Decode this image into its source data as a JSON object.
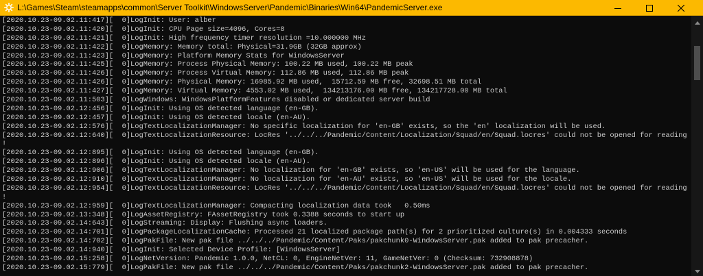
{
  "window": {
    "title": "L:\\Games\\Steam\\steamapps\\common\\Server Toolkit\\WindowsServer\\Pandemic\\Binaries\\Win64\\PandemicServer.exe",
    "titlebar_color": "#fcb900",
    "console_background": "#0c0c0c",
    "console_text_color": "#cccccc",
    "icon": "app-gear-icon"
  },
  "controls": {
    "minimize_icon": "minimize-icon",
    "maximize_icon": "maximize-icon",
    "close_icon": "close-icon"
  },
  "console": {
    "lines": [
      "[2020.10.23-09.02.11:417][  0]LogInit: User: alber",
      "[2020.10.23-09.02.11:420][  0]LogInit: CPU Page size=4096, Cores=8",
      "[2020.10.23-09.02.11:421][  0]LogInit: High frequency timer resolution =10.000000 MHz",
      "[2020.10.23-09.02.11:422][  0]LogMemory: Memory total: Physical=31.9GB (32GB approx)",
      "[2020.10.23-09.02.11:423][  0]LogMemory: Platform Memory Stats for WindowsServer",
      "[2020.10.23-09.02.11:425][  0]LogMemory: Process Physical Memory: 100.22 MB used, 100.22 MB peak",
      "[2020.10.23-09.02.11:426][  0]LogMemory: Process Virtual Memory: 112.86 MB used, 112.86 MB peak",
      "[2020.10.23-09.02.11:426][  0]LogMemory: Physical Memory: 16985.92 MB used,  15712.59 MB free, 32698.51 MB total",
      "[2020.10.23-09.02.11:427][  0]LogMemory: Virtual Memory: 4553.02 MB used,  134213176.00 MB free, 134217728.00 MB total",
      "[2020.10.23-09.02.11:503][  0]LogWindows: WindowsPlatformFeatures disabled or dedicated server build",
      "[2020.10.23-09.02.12:456][  0]LogInit: Using OS detected language (en-GB).",
      "[2020.10.23-09.02.12:457][  0]LogInit: Using OS detected locale (en-AU).",
      "[2020.10.23-09.02.12:576][  0]LogTextLocalizationManager: No specific localization for 'en-GB' exists, so the 'en' localization will be used.",
      "[2020.10.23-09.02.12:640][  0]LogTextLocalizationResource: LocRes '../../../Pandemic/Content/Localization/Squad/en/Squad.locres' could not be opened for reading",
      "!",
      "[2020.10.23-09.02.12:895][  0]LogInit: Using OS detected language (en-GB).",
      "[2020.10.23-09.02.12:896][  0]LogInit: Using OS detected locale (en-AU).",
      "[2020.10.23-09.02.12:906][  0]LogTextLocalizationManager: No localization for 'en-GB' exists, so 'en-US' will be used for the language.",
      "[2020.10.23-09.02.12:910][  0]LogTextLocalizationManager: No localization for 'en-AU' exists, so 'en-US' will be used for the locale.",
      "[2020.10.23-09.02.12:954][  0]LogTextLocalizationResource: LocRes '../../../Pandemic/Content/Localization/Squad/en/Squad.locres' could not be opened for reading",
      "!",
      "[2020.10.23-09.02.12:959][  0]LogTextLocalizationManager: Compacting localization data took   0.50ms",
      "[2020.10.23-09.02.13:348][  0]LogAssetRegistry: FAssetRegistry took 0.3388 seconds to start up",
      "[2020.10.23-09.02.14:643][  0]LogStreaming: Display: Flushing async loaders.",
      "[2020.10.23-09.02.14:701][  0]LogPackageLocalizationCache: Processed 21 localized package path(s) for 2 prioritized culture(s) in 0.004333 seconds",
      "[2020.10.23-09.02.14:702][  0]LogPakFile: New pak file ../../../Pandemic/Content/Paks/pakchunk0-WindowsServer.pak added to pak precacher.",
      "[2020.10.23-09.02.14:940][  0]LogInit: Selected Device Profile: [WindowsServer]",
      "[2020.10.23-09.02.15:258][  0]LogNetVersion: Pandemic 1.0.0, NetCL: 0, EngineNetVer: 11, GameNetVer: 0 (Checksum: 732908878)",
      "[2020.10.23-09.02.15:779][  0]LogPakFile: New pak file ../../../Pandemic/Content/Paks/pakchunk2-WindowsServer.pak added to pak precacher."
    ]
  },
  "scrollbar": {
    "up_icon": "scroll-up-arrow-icon",
    "down_icon": "scroll-down-arrow-icon"
  }
}
